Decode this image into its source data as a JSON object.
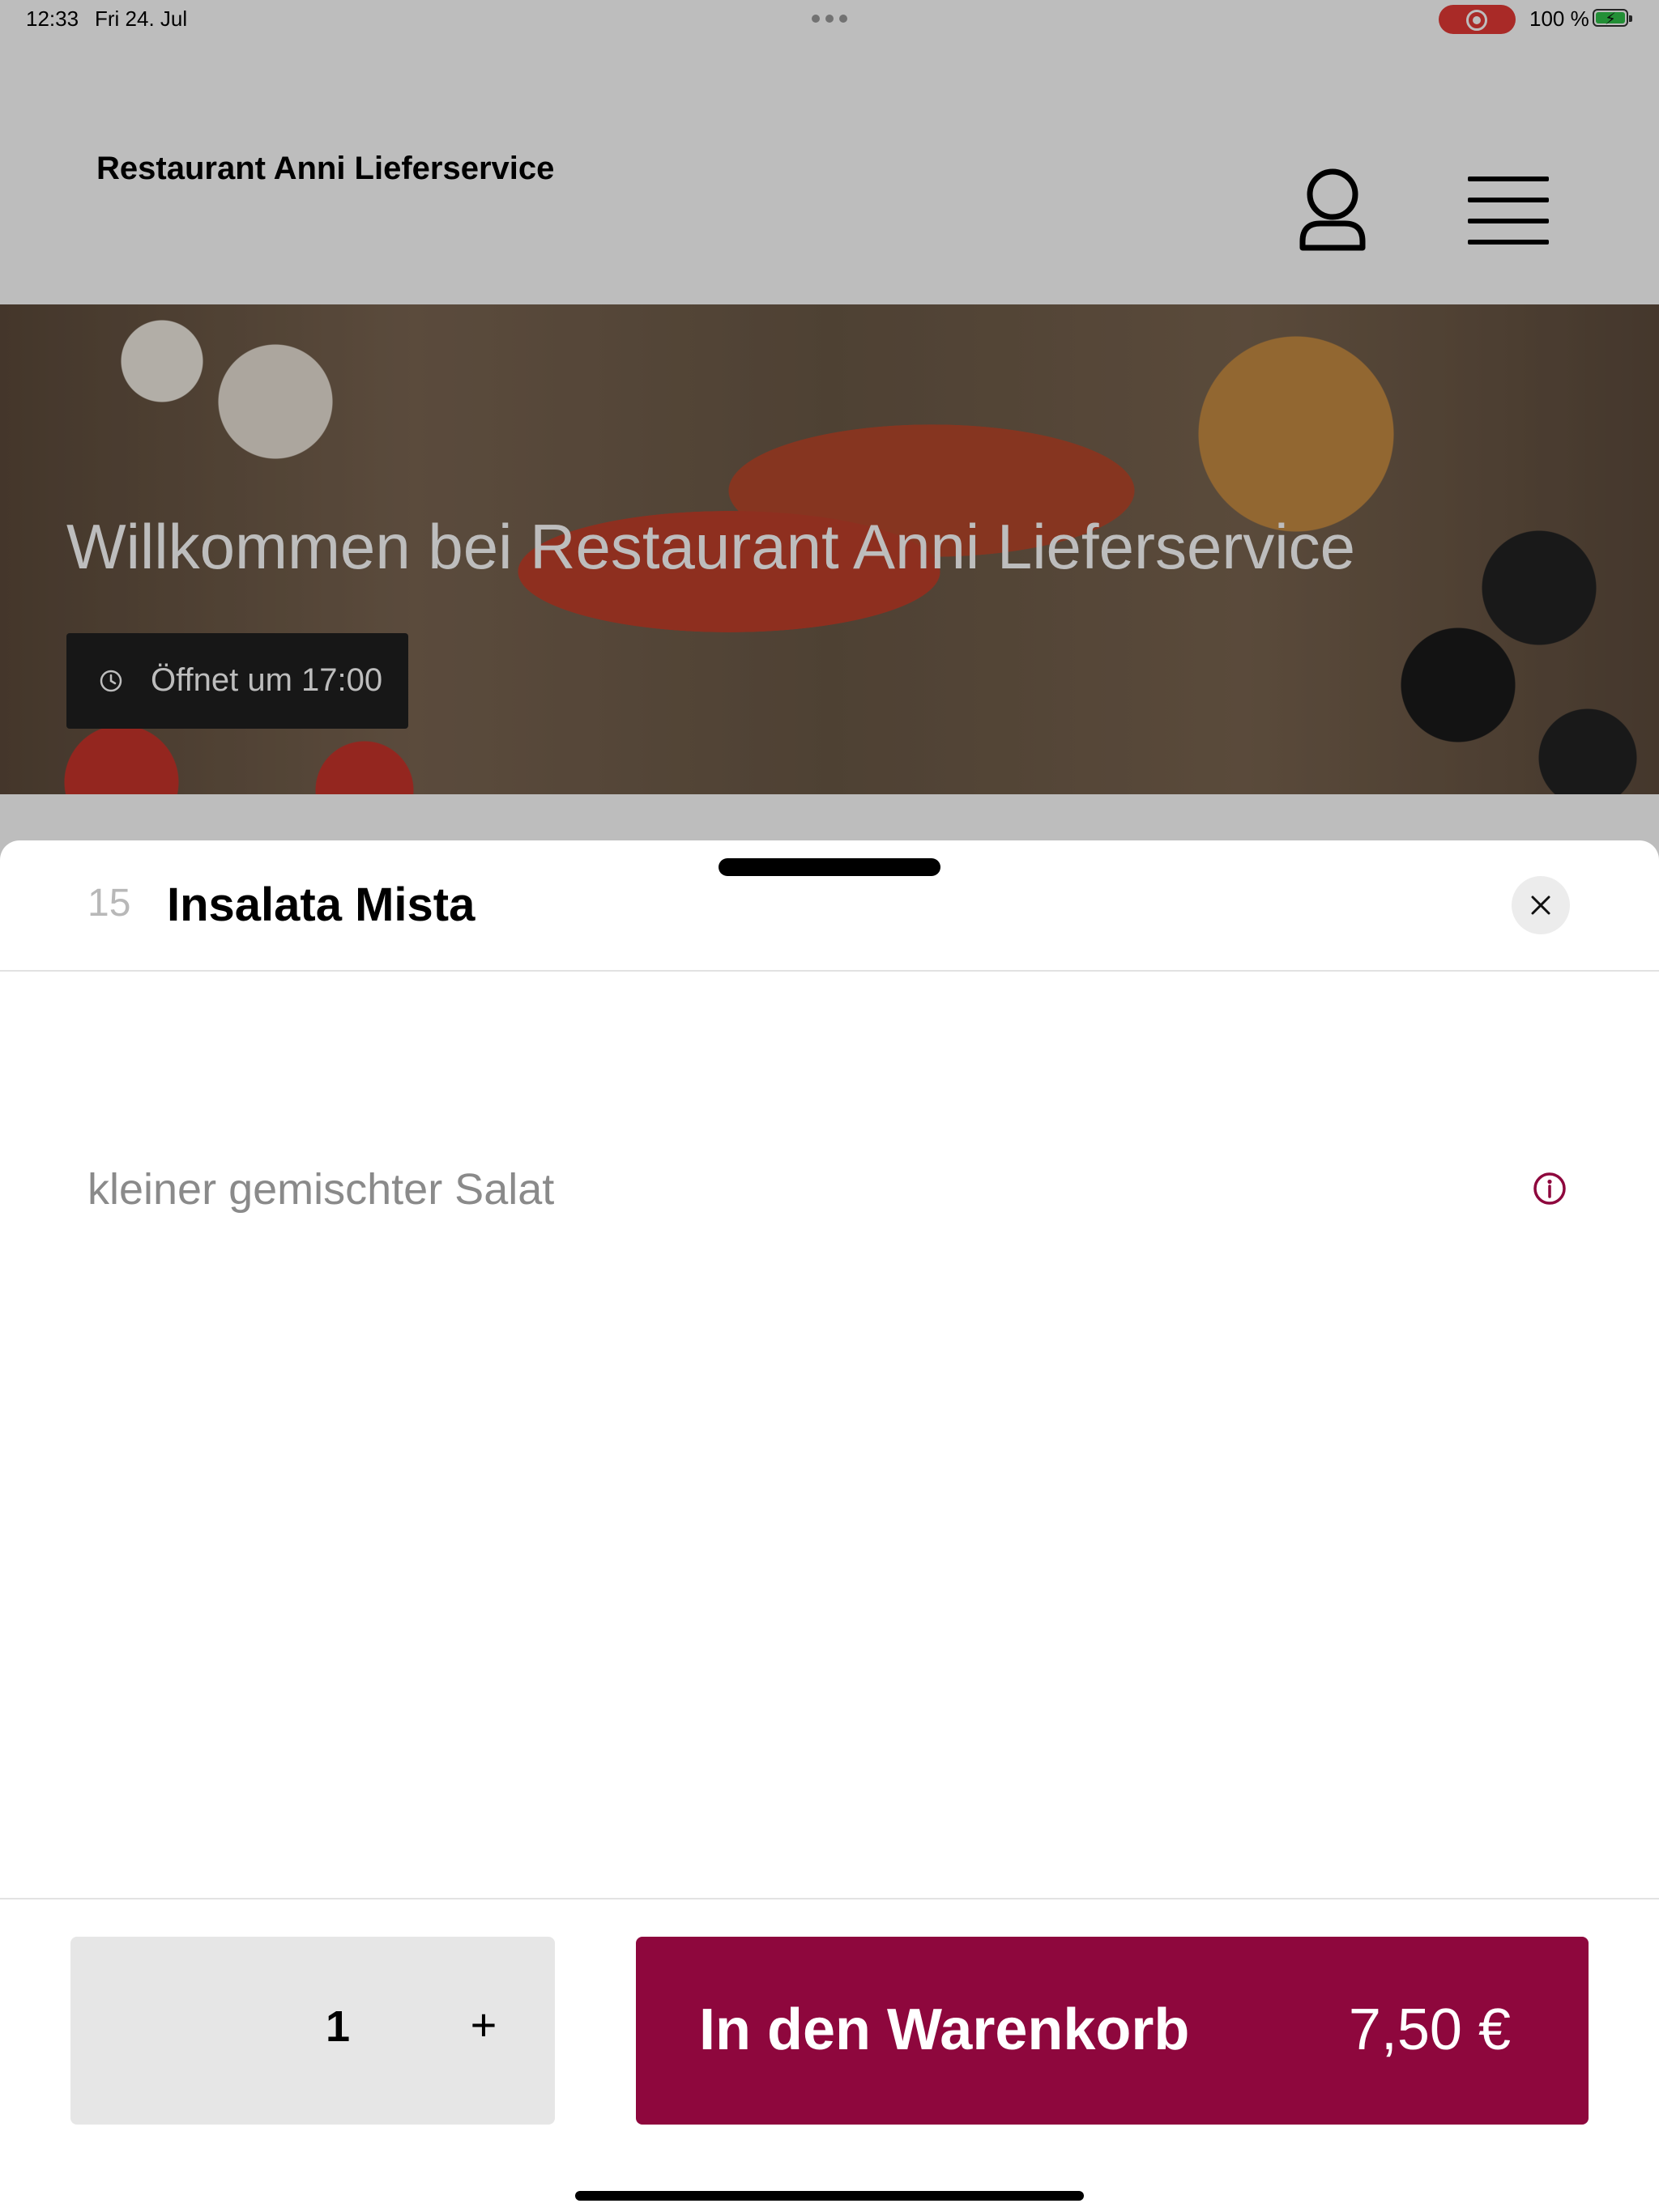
{
  "status_bar": {
    "time": "12:33",
    "date": "Fri 24. Jul",
    "battery": "100 %"
  },
  "header": {
    "brand": "Restaurant Anni Lieferservice",
    "icons": [
      "user-icon",
      "menu-icon"
    ]
  },
  "hero": {
    "title": "Willkommen bei Restaurant Anni Lieferservice",
    "opening_hours": "Öffnet um 17:00"
  },
  "item_sheet": {
    "number": "15",
    "title": "Insalata Mista",
    "description": "kleiner gemischter Salat",
    "quantity": "1",
    "plus_label": "+",
    "add_to_cart_label": "In den Warenkorb",
    "price": "7,50 €"
  },
  "colors": {
    "accent": "#8e073d",
    "overlay": "rgba(0,0,0,0.26)",
    "quantity_bg": "#e6e6e6",
    "recording": "#e53935",
    "battery_fill": "#30c24a"
  }
}
